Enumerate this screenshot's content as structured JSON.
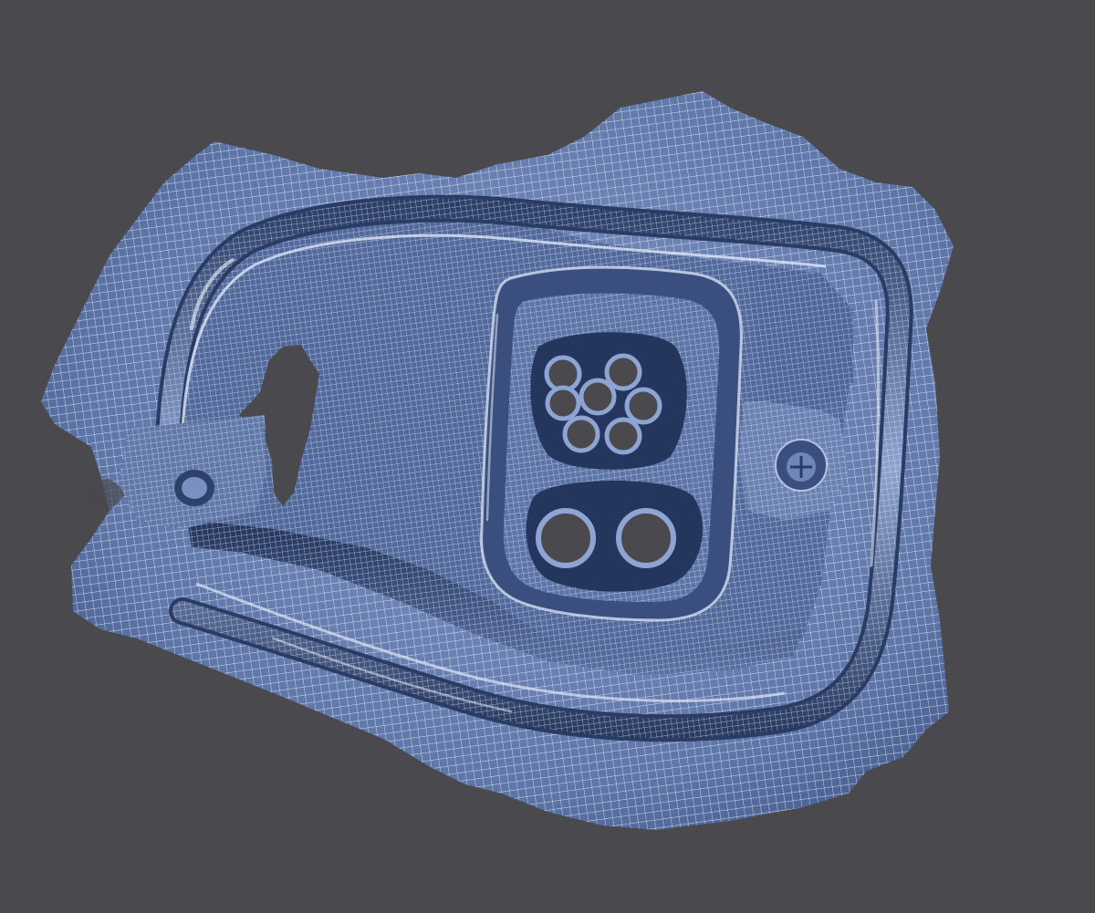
{
  "viewport": {
    "background_color": "#4a494e"
  },
  "model": {
    "subject": "ev-charging-port-inlet-scan",
    "render_style": "wireframe-mesh",
    "mesh_color": "#7d95c6",
    "mesh_shadow_color": "#1f2f52",
    "mesh_line_color": "#e9eefa",
    "highlight_color": "#dfe7f7",
    "background_hole_color": "#4a494e"
  }
}
